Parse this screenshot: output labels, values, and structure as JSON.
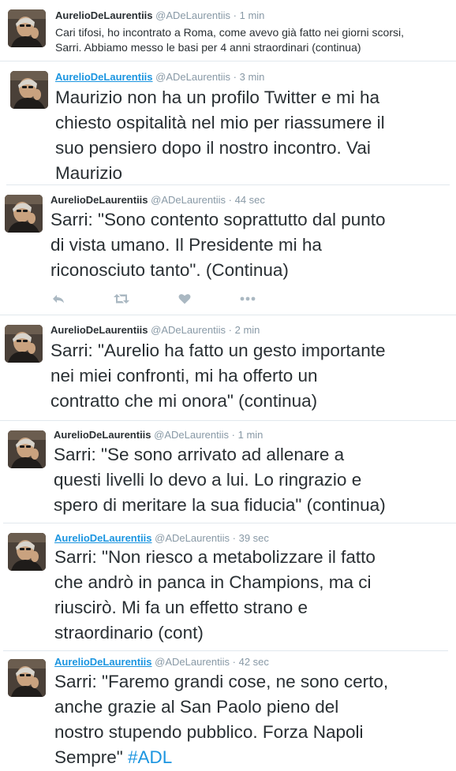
{
  "tweets": [
    {
      "name": "AurelioDeLaurentiis",
      "handle": "@ADeLaurentiis",
      "separator": "·",
      "time": "1 min",
      "text": "Cari tifosi, ho incontrato a Roma, come avevo già fatto nei giorni scorsi,\nSarri. Abbiamo messo le basi per 4 anni straordinari (continua)"
    },
    {
      "name": "AurelioDeLaurentiis",
      "handle": "@ADeLaurentiis",
      "separator": "·",
      "time": "3 min",
      "text": "Maurizio non ha un profilo Twitter e mi ha\nchiesto ospitalità nel mio per riassumere il\nsuo pensiero dopo il nostro incontro. Vai\nMaurizio"
    },
    {
      "name": "AurelioDeLaurentiis",
      "handle": "@ADeLaurentiis",
      "separator": "·",
      "time": "44 sec",
      "text": "Sarri: \"Sono contento soprattutto dal punto\ndi vista umano. Il Presidente mi ha\nriconosciuto tanto\". (Continua)",
      "actions": [
        "reply-icon",
        "retweet-icon",
        "like-icon",
        "more-icon"
      ]
    },
    {
      "name": "AurelioDeLaurentiis",
      "handle": "@ADeLaurentiis",
      "separator": "·",
      "time": "2 min",
      "text": "Sarri: \"Aurelio ha fatto un gesto importante\nnei miei confronti, mi ha offerto un\ncontratto che mi onora\" (continua)"
    },
    {
      "name": "AurelioDeLaurentiis",
      "handle": "@ADeLaurentiis",
      "separator": "·",
      "time": "1 min",
      "text": "Sarri: \"Se sono arrivato ad allenare a\nquesti livelli lo devo a lui. Lo ringrazio e\nspero di meritare la sua fiducia\" (continua)"
    },
    {
      "name": "AurelioDeLaurentiis",
      "handle": "@ADeLaurentiis",
      "separator": "·",
      "time": "39 sec",
      "text": "Sarri: \"Non riesco a metabolizzare il fatto\nche andrò in panca in Champions, ma ci\nriuscirò. Mi fa un effetto strano e\nstraordinario (cont)"
    },
    {
      "name": "AurelioDeLaurentiis",
      "handle": "@ADeLaurentiis",
      "separator": "·",
      "time": "42 sec",
      "text": "Sarri: \"Faremo grandi cose, ne sono certo,\nanche grazie al San Paolo pieno del\nnostro stupendo pubblico. Forza Napoli\nSempre\" ",
      "hashtag": "#ADL"
    }
  ],
  "colors": {
    "name": "#292f33",
    "name_link": "#1b95e0",
    "meta": "#8899a6",
    "text": "#292f33",
    "hashtag": "#1b95e0",
    "action_icon": "#aab8c2",
    "divider": "#e1e8ed"
  }
}
